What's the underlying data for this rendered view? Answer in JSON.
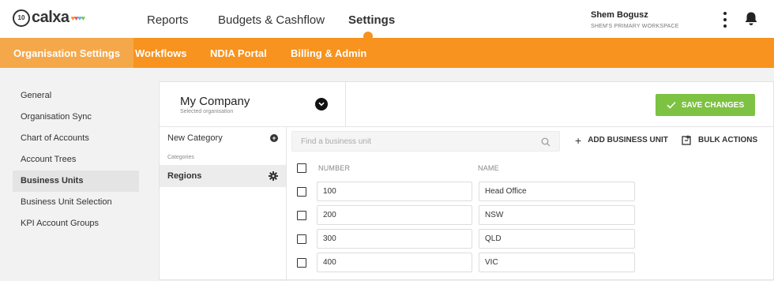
{
  "brand": {
    "badge": "10",
    "name": "calxa",
    "hearts": "♥♥♥♥",
    "accent": "#f7931e",
    "green": "#7dc242"
  },
  "nav": {
    "items": [
      "Reports",
      "Budgets & Cashflow",
      "Settings"
    ],
    "active": "Settings"
  },
  "user": {
    "name": "Shem Bogusz",
    "workspace": "SHEM'S PRIMARY WORKSPACE"
  },
  "subnav": {
    "items": [
      "Organisation Settings",
      "Workflows",
      "NDIA Portal",
      "Billing & Admin"
    ],
    "active": "Organisation Settings"
  },
  "sidebar": {
    "items": [
      {
        "label": "General"
      },
      {
        "label": "Organisation Sync"
      },
      {
        "label": "Chart of Accounts"
      },
      {
        "label": "Account Trees"
      },
      {
        "label": "Business Units"
      },
      {
        "label": "Business Unit Selection"
      },
      {
        "label": "KPI Account Groups"
      }
    ],
    "active": "Business Units"
  },
  "organisation": {
    "name": "My Company",
    "caption": "Selected organisation"
  },
  "toolbar": {
    "save_label": "SAVE CHANGES",
    "add_label": "ADD BUSINESS UNIT",
    "bulk_label": "BULK ACTIONS"
  },
  "categories": {
    "new_label": "New Category",
    "section_label": "Categories",
    "items": [
      "Regions"
    ]
  },
  "search": {
    "placeholder": "Find a business unit",
    "value": ""
  },
  "table": {
    "headers": {
      "number": "NUMBER",
      "name": "NAME"
    },
    "rows": [
      {
        "number": "100",
        "name": "Head Office"
      },
      {
        "number": "200",
        "name": "NSW"
      },
      {
        "number": "300",
        "name": "QLD"
      },
      {
        "number": "400",
        "name": "VIC"
      }
    ]
  }
}
